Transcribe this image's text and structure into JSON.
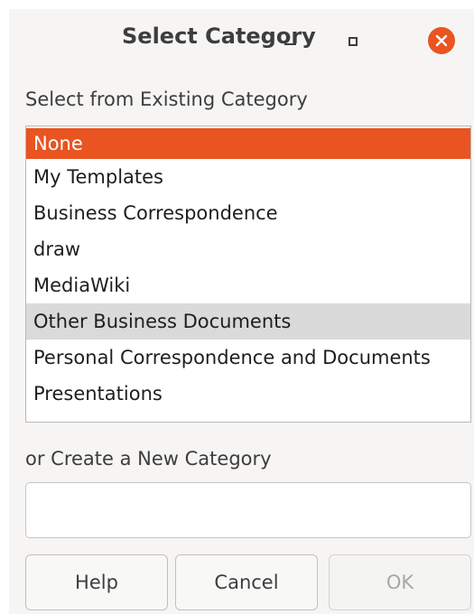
{
  "window": {
    "title": "Select Category",
    "controls": {
      "minimize_icon": "minimize-icon",
      "maximize_icon": "maximize-icon",
      "close_icon": "close-icon",
      "close_color": "#e95420"
    }
  },
  "existing": {
    "label": "Select from Existing Category",
    "items": [
      {
        "label": "None",
        "state": "selected"
      },
      {
        "label": "My Templates",
        "state": "normal"
      },
      {
        "label": "Business Correspondence",
        "state": "normal"
      },
      {
        "label": "draw",
        "state": "normal"
      },
      {
        "label": "MediaWiki",
        "state": "normal"
      },
      {
        "label": "Other Business Documents",
        "state": "hover"
      },
      {
        "label": "Personal Correspondence and Documents",
        "state": "normal"
      },
      {
        "label": "Presentations",
        "state": "normal"
      }
    ],
    "selected_color": "#e95420",
    "hover_color": "#dadada"
  },
  "new_category": {
    "label": "or Create a New Category",
    "value": "",
    "placeholder": ""
  },
  "buttons": {
    "help": "Help",
    "cancel": "Cancel",
    "ok": "OK",
    "ok_enabled": false
  }
}
